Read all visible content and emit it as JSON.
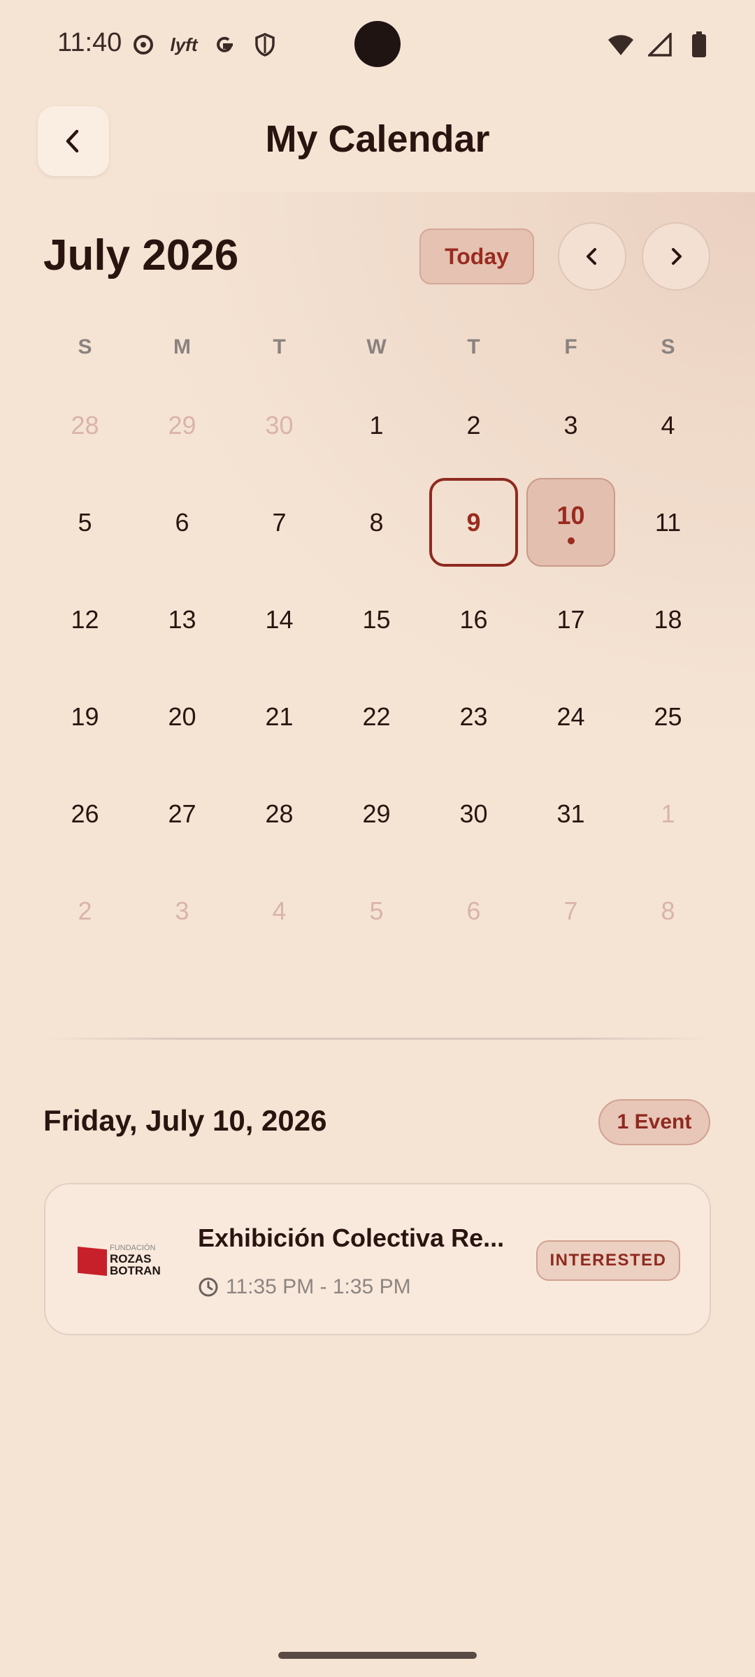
{
  "status_bar": {
    "time": "11:40",
    "icons_left": [
      "podcast-icon",
      "lyft-icon",
      "google-icon",
      "shield-icon"
    ],
    "lyft_label": "lyft",
    "icons_right": [
      "wifi-icon",
      "signal-icon",
      "battery-icon"
    ]
  },
  "header": {
    "title": "My Calendar"
  },
  "calendar": {
    "month_title": "July 2026",
    "today_label": "Today",
    "weekdays": [
      "S",
      "M",
      "T",
      "W",
      "T",
      "F",
      "S"
    ],
    "weeks": [
      [
        "28",
        "29",
        "30",
        "1",
        "2",
        "3",
        "4"
      ],
      [
        "5",
        "6",
        "7",
        "8",
        "9",
        "10",
        "11"
      ],
      [
        "12",
        "13",
        "14",
        "15",
        "16",
        "17",
        "18"
      ],
      [
        "19",
        "20",
        "21",
        "22",
        "23",
        "24",
        "25"
      ],
      [
        "26",
        "27",
        "28",
        "29",
        "30",
        "31",
        "1"
      ],
      [
        "2",
        "3",
        "4",
        "5",
        "6",
        "7",
        "8"
      ]
    ],
    "today_day": "9",
    "selected_day": "10"
  },
  "day_detail": {
    "selected_date": "Friday, July 10, 2026",
    "event_count": "1 Event"
  },
  "event": {
    "logo_text_top": "FUNDACIÓN",
    "logo_text_mid": "ROZAS",
    "logo_text_bottom": "BOTRAN",
    "title": "Exhibición Colectiva Re...",
    "time": "11:35 PM - 1:35 PM",
    "status": "INTERESTED"
  },
  "colors": {
    "background": "#f5e4d4",
    "accent": "#9a2b20",
    "selected_fill": "#e3bfb0"
  }
}
